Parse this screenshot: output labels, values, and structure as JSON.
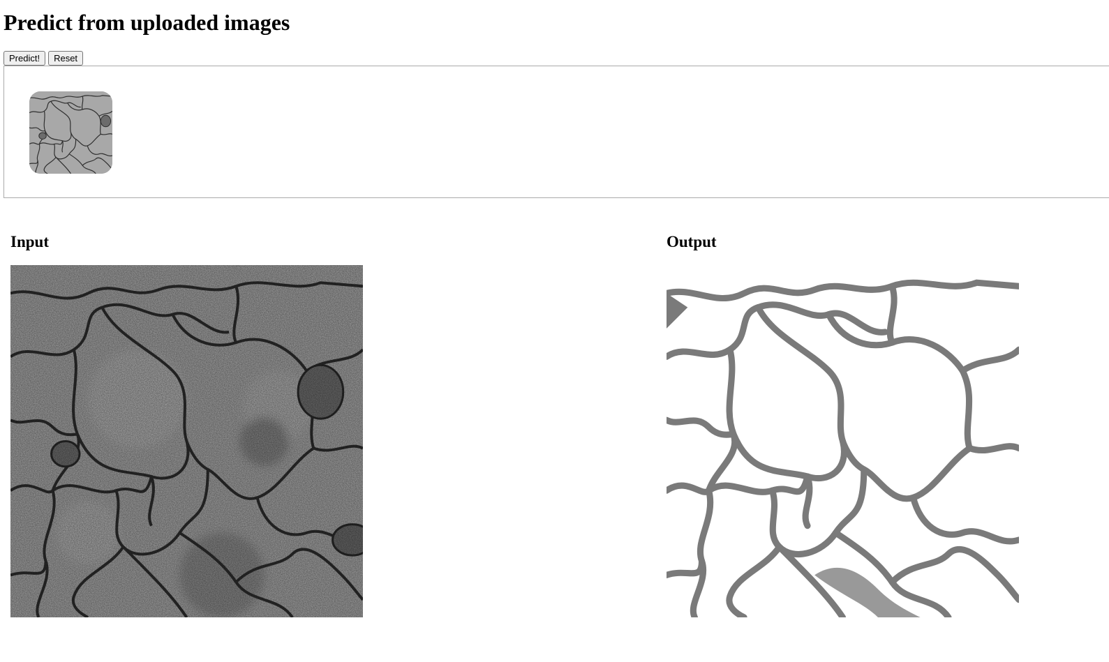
{
  "page": {
    "title": "Predict from uploaded images"
  },
  "toolbar": {
    "predict_label": "Predict!",
    "reset_label": "Reset"
  },
  "dropzone": {
    "uploaded_count": 1
  },
  "panels": {
    "input_title": "Input",
    "output_title": "Output"
  },
  "colors": {
    "membrane_input": "#2e2e2e",
    "cytoplasm_input": "#a6a6a6",
    "membrane_output": "#7a7a7a",
    "background_output": "#ffffff"
  }
}
